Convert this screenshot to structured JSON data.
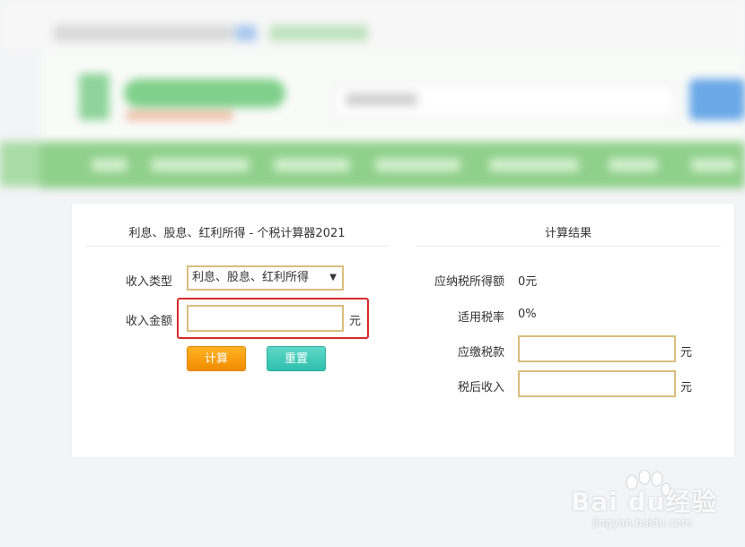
{
  "calculator": {
    "title": "利息、股息、红利所得 - 个税计算器2021",
    "income_type_label": "收入类型",
    "income_type_selected": "利息、股息、红利所得",
    "income_amount_label": "收入金额",
    "income_amount_value": "",
    "unit": "元",
    "calc_button": "计算",
    "reset_button": "重置"
  },
  "result": {
    "title": "计算结果",
    "taxable_income_label": "应纳税所得额",
    "taxable_income_value": "0元",
    "tax_rate_label": "适用税率",
    "tax_rate_value": "0%",
    "tax_payable_label": "应缴税款",
    "tax_payable_value": "",
    "after_tax_label": "税后收入",
    "after_tax_value": "",
    "unit": "元"
  },
  "watermark": {
    "brand": "Bai du经验",
    "url": "jingyan.baidu.com"
  },
  "colors": {
    "input_border": "#d8be7e",
    "highlight": "#d52b2b",
    "calc_button": "#f39a0c",
    "reset_button": "#3cc6b5",
    "nav_green": "#8fd08b"
  }
}
